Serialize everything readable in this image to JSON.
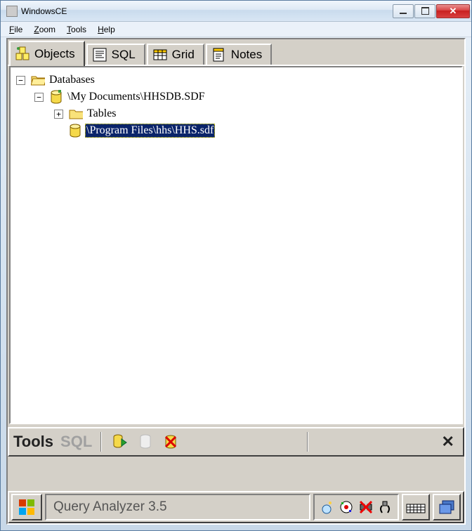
{
  "window": {
    "title": "WindowsCE"
  },
  "menu": {
    "file": "File",
    "zoom": "Zoom",
    "tools": "Tools",
    "help": "Help"
  },
  "tabs": {
    "objects": "Objects",
    "sql": "SQL",
    "grid": "Grid",
    "notes": "Notes"
  },
  "tree": {
    "root": "Databases",
    "db1": "\\My Documents\\HHSDB.SDF",
    "db1_tables": "Tables",
    "db2": "\\Program Files\\hhs\\HHS.sdf"
  },
  "tools_strip": {
    "label": "Tools",
    "sql": "SQL"
  },
  "taskbar": {
    "app": "Query Analyzer 3.5"
  }
}
